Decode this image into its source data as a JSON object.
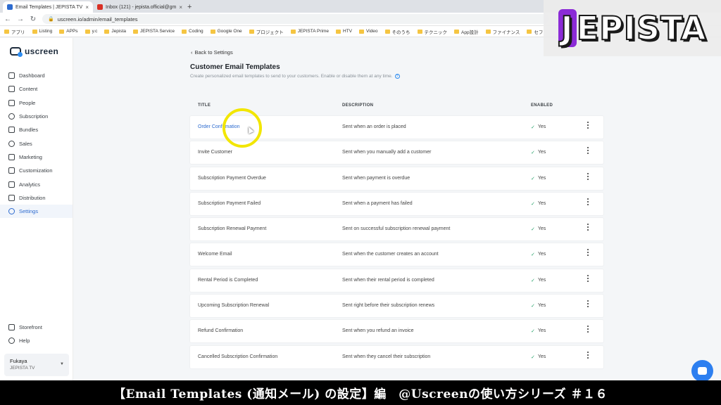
{
  "browser": {
    "tabs": [
      {
        "label": "Email Templates | JEPISTA TV",
        "active": true,
        "icon_color": "#2d6bcf"
      },
      {
        "label": "Inbox (121) - jepista.official@gm",
        "active": false,
        "icon_color": "#d93025"
      }
    ],
    "url": "uscreen.io/admin/email_templates",
    "bookmarks": [
      "アプリ",
      "Listing",
      "APPs",
      "y.c",
      "Jepista",
      "JEPISTA Service",
      "Coding",
      "Google One",
      "プロジェクト",
      "JEPISTA Prime",
      "HTV",
      "Video",
      "そのうち",
      "テクニック",
      "App設計",
      "ファイナンス",
      "セフ"
    ]
  },
  "overlay_logo": "JEPISTA",
  "app": {
    "logo_text": "uscreen",
    "nav": [
      {
        "label": "Dashboard",
        "icon": "grid-icon"
      },
      {
        "label": "Content",
        "icon": "folder-icon"
      },
      {
        "label": "People",
        "icon": "people-icon"
      },
      {
        "label": "Subscription",
        "icon": "refresh-icon"
      },
      {
        "label": "Bundles",
        "icon": "box-icon"
      },
      {
        "label": "Sales",
        "icon": "dollar-icon"
      },
      {
        "label": "Marketing",
        "icon": "megaphone-icon"
      },
      {
        "label": "Customization",
        "icon": "edit-icon"
      },
      {
        "label": "Analytics",
        "icon": "chart-icon"
      },
      {
        "label": "Distribution",
        "icon": "share-icon"
      },
      {
        "label": "Settings",
        "icon": "gear-icon",
        "active": true
      }
    ],
    "nav_bottom": [
      {
        "label": "Storefront",
        "icon": "storefront-icon"
      },
      {
        "label": "Help",
        "icon": "help-icon"
      }
    ],
    "account": {
      "name": "Fukaya",
      "org": "JEPISTA TV"
    }
  },
  "main": {
    "back_label": "Back to Settings",
    "title": "Customer Email Templates",
    "subtitle": "Create personalized email templates to send to your customers. Enable or disable them at any time.",
    "columns": {
      "title": "TITLE",
      "description": "DESCRIPTION",
      "enabled": "ENABLED"
    },
    "rows": [
      {
        "title": "Order Confirmation",
        "description": "Sent when an order is placed",
        "enabled": "Yes"
      },
      {
        "title": "Invite Customer",
        "description": "Sent when you manually add a customer",
        "enabled": "Yes"
      },
      {
        "title": "Subscription Payment Overdue",
        "description": "Sent when payment is overdue",
        "enabled": "Yes"
      },
      {
        "title": "Subscription Payment Failed",
        "description": "Sent when a payment has failed",
        "enabled": "Yes"
      },
      {
        "title": "Subscription Renewal Payment",
        "description": "Sent on successful subscription renewal payment",
        "enabled": "Yes"
      },
      {
        "title": "Welcome Email",
        "description": "Sent when the customer creates an account",
        "enabled": "Yes"
      },
      {
        "title": "Rental Period is Completed",
        "description": "Sent when their rental period is completed",
        "enabled": "Yes"
      },
      {
        "title": "Upcoming Subscription Renewal",
        "description": "Sent right before their subscription renews",
        "enabled": "Yes"
      },
      {
        "title": "Refund Confirmation",
        "description": "Sent when you refund an invoice",
        "enabled": "Yes"
      },
      {
        "title": "Cancelled Subscription Confirmation",
        "description": "Sent when they cancel their subscription",
        "enabled": "Yes"
      }
    ]
  },
  "caption": "【Email Templates (通知メール) の設定】編　@Uscreenの使い方シリーズ ＃１６",
  "colors": {
    "accent": "#2d6bcf",
    "success": "#2aa36b",
    "highlight": "#f2e600",
    "chat": "#2d7ff0"
  }
}
